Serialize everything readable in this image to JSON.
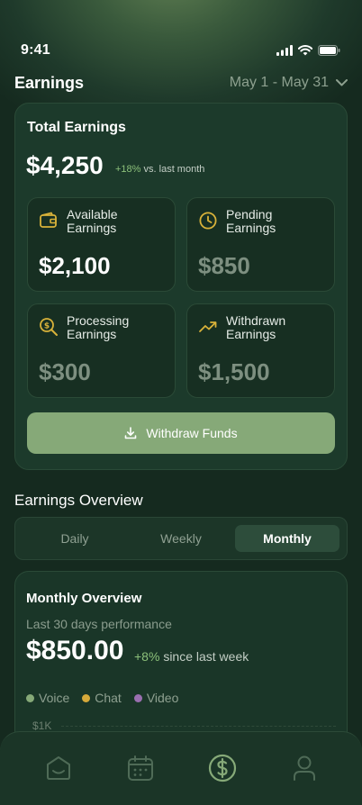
{
  "status": {
    "time": "9:41"
  },
  "header": {
    "title": "Earnings",
    "date_range": "May 1 - May 31"
  },
  "total": {
    "label": "Total Earnings",
    "value": "$4,250",
    "change_pct": "+18%",
    "change_text": "vs. last month"
  },
  "tiles": [
    {
      "label_line1": "Available",
      "label_line2": "Earnings",
      "value": "$2,100",
      "icon": "wallet-icon"
    },
    {
      "label_line1": "Pending",
      "label_line2": "Earnings",
      "value": "$850",
      "icon": "clock-icon"
    },
    {
      "label_line1": "Processing",
      "label_line2": "Earnings",
      "value": "$300",
      "icon": "dollar-search-icon"
    },
    {
      "label_line1": "Withdrawn",
      "label_line2": "Earnings",
      "value": "$1,500",
      "icon": "trending-up-icon"
    }
  ],
  "withdraw_button": {
    "label": "Withdraw Funds"
  },
  "overview_section": {
    "title": "Earnings Overview"
  },
  "tabs": [
    {
      "label": "Daily"
    },
    {
      "label": "Weekly"
    },
    {
      "label": "Monthly",
      "active": true
    }
  ],
  "overview": {
    "title": "Monthly Overview",
    "subtitle": "Last 30 days performance",
    "value": "$850.00",
    "change_pct": "+8%",
    "change_text": "since last week",
    "legend": [
      {
        "label": "Voice",
        "color": "#86a978"
      },
      {
        "label": "Chat",
        "color": "#d6a93a"
      },
      {
        "label": "Video",
        "color": "#9a6fb0"
      }
    ],
    "y_tick": "$1K"
  },
  "colors": {
    "accent": "#86a978",
    "gold_icon": "#d8b23a",
    "positive": "#8cc07a"
  },
  "nav": [
    {
      "name": "home-icon"
    },
    {
      "name": "calendar-icon"
    },
    {
      "name": "earnings-icon",
      "active": true
    },
    {
      "name": "profile-icon"
    }
  ]
}
